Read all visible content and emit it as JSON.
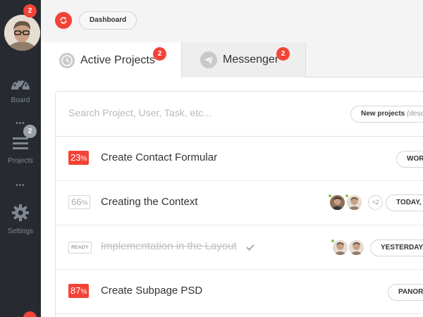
{
  "sidebar": {
    "avatar_badge": "2",
    "items": [
      {
        "label": "Board",
        "icon": "gauge-icon"
      },
      {
        "label": "Projects",
        "icon": "menu-icon",
        "badge": "2"
      },
      {
        "label": "Settings",
        "icon": "gear-icon"
      }
    ],
    "dots": "•••"
  },
  "topbar": {
    "refresh_icon": "refresh-icon",
    "breadcrumb": "Dashboard"
  },
  "tabs": [
    {
      "label": "Active Projects",
      "badge": "2",
      "icon": "clock-icon",
      "active": true
    },
    {
      "label": "Messenger",
      "badge": "2",
      "icon": "send-icon",
      "active": false
    }
  ],
  "search": {
    "placeholder": "Search Project, User, Task, etc...",
    "value": "",
    "new_projects_label": "New projects",
    "new_projects_sort": "(desc"
  },
  "tasks": [
    {
      "percent": "23",
      "percent_sign": "%",
      "status": "red",
      "title": "Create Contact Formular",
      "due": "WOR"
    },
    {
      "percent": "66",
      "percent_sign": "%",
      "status": "outline",
      "title": "Creating the Context",
      "extra_users": "+2",
      "due": "TODAY, "
    },
    {
      "percent": "READY",
      "status": "ready",
      "title": "Implementation in the Layout",
      "done": true,
      "due": "YESTERDAY, "
    },
    {
      "percent": "87",
      "percent_sign": "%",
      "status": "red",
      "title": "Create Subpage PSD",
      "due": "PANORA"
    }
  ],
  "colors": {
    "accent": "#f44336",
    "sidebar": "#272b31",
    "online": "#8bc34a"
  }
}
